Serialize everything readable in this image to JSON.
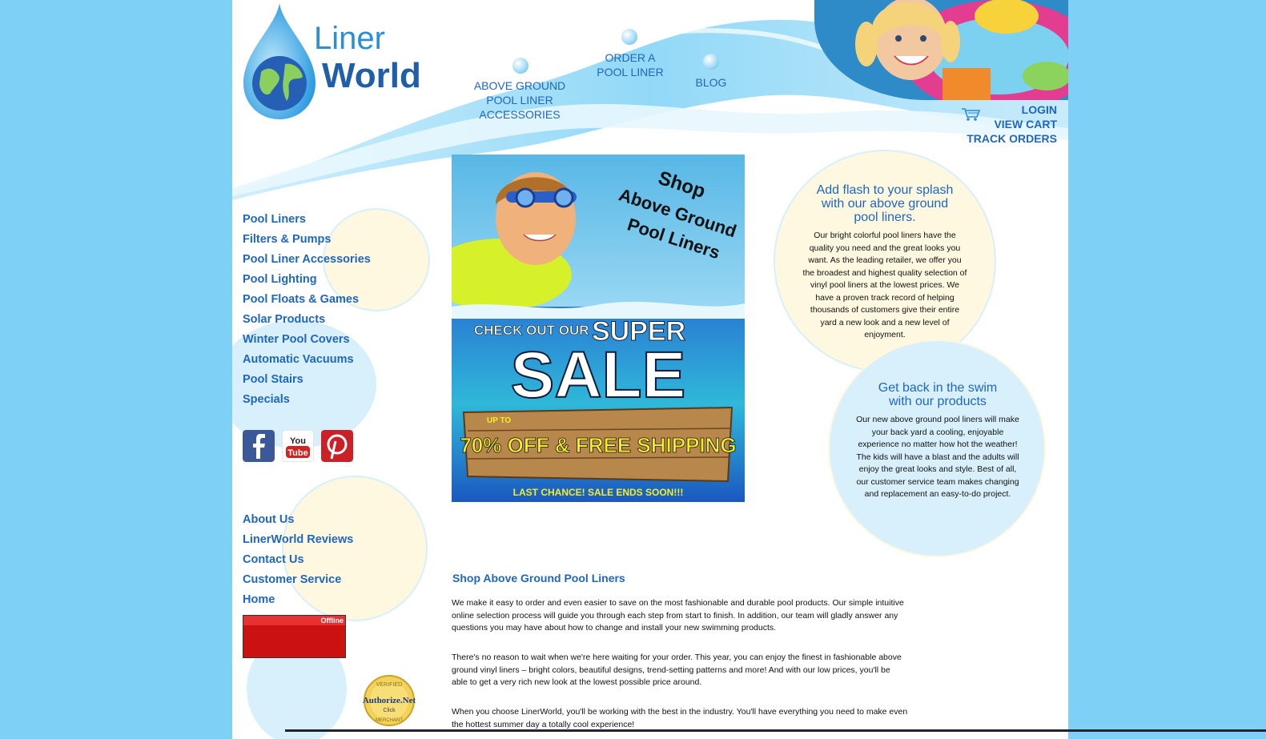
{
  "logo": {
    "line1": "Liner",
    "line2": "World"
  },
  "topnav": {
    "accessories": "ABOVE GROUND POOL LINER ACCESSORIES",
    "order": "ORDER A POOL LINER",
    "blog": "BLOG"
  },
  "account": {
    "login": "LOGIN",
    "cart": "VIEW CART",
    "track": "TRACK ORDERS"
  },
  "sidebar": {
    "categories": [
      "Pool Liners",
      "Filters & Pumps",
      "Pool Liner Accessories",
      "Pool Lighting",
      "Pool Floats & Games",
      "Solar Products",
      "Winter Pool Covers",
      "Automatic Vacuums",
      "Pool Stairs",
      "Specials"
    ],
    "info": [
      "About Us",
      "LinerWorld Reviews",
      "Contact Us",
      "Customer Service",
      "Home"
    ],
    "chat_status": "Offline",
    "seal": {
      "line1": "VERIFIED",
      "line2": "Authorize.Net",
      "line3": "Click",
      "line4": "MERCHANT"
    }
  },
  "banner": {
    "shop": "Shop",
    "above": "Above Ground",
    "liners": "Pool Liners",
    "check": "CHECK OUT OUR",
    "super": "SUPER",
    "sale": "SALE",
    "upto": "UP TO",
    "offer": "70% OFF & FREE SHIPPING",
    "last": "LAST CHANCE! SALE ENDS SOON!!!"
  },
  "promo1": {
    "title": "Add flash to your splash with our above ground pool liners.",
    "body": "Our bright colorful pool liners have the quality you need and the great looks you want. As the leading retailer, we offer you the broadest and highest quality selection of vinyl pool liners at the lowest prices. We have a proven track record of helping thousands of customers give their entire yard a new look and a new level of enjoyment."
  },
  "promo2": {
    "title": "Get back in the swim with our products",
    "body": "Our new above ground pool liners will make your back yard a cooling, enjoyable experience no matter how hot the weather! The kids will have a blast and the adults will enjoy the great looks and style. Best of all, our customer service team makes changing and replacement an easy-to-do project."
  },
  "content": {
    "heading": "Shop Above Ground Pool Liners",
    "p1": "We make it easy to order and even easier to save on the most fashionable and durable pool products. Our simple intuitive online selection process will guide you through each step from start to finish. In addition, our team will gladly answer any questions you may have about how to change and install your new swimming products.",
    "p2": "There's no reason to wait when we're here waiting for your order. This year, you can enjoy the finest in fashionable above ground vinyl liners – bright colors, beautiful designs, trend-setting patterns and more! And with our low prices, you'll be able to get a very rich new look at the lowest possible price around.",
    "p3": "When you choose LinerWorld, you'll be working with the best in the industry. You'll have everything you need to make even the hottest summer day a totally cool experience!"
  },
  "colors": {
    "link": "#1f66c1",
    "sky": "#7fd0f7",
    "cream": "#fdf8df",
    "lightblue": "#d8f0fc"
  },
  "icons": [
    "cart-icon",
    "facebook-icon",
    "youtube-icon",
    "pinterest-icon"
  ]
}
